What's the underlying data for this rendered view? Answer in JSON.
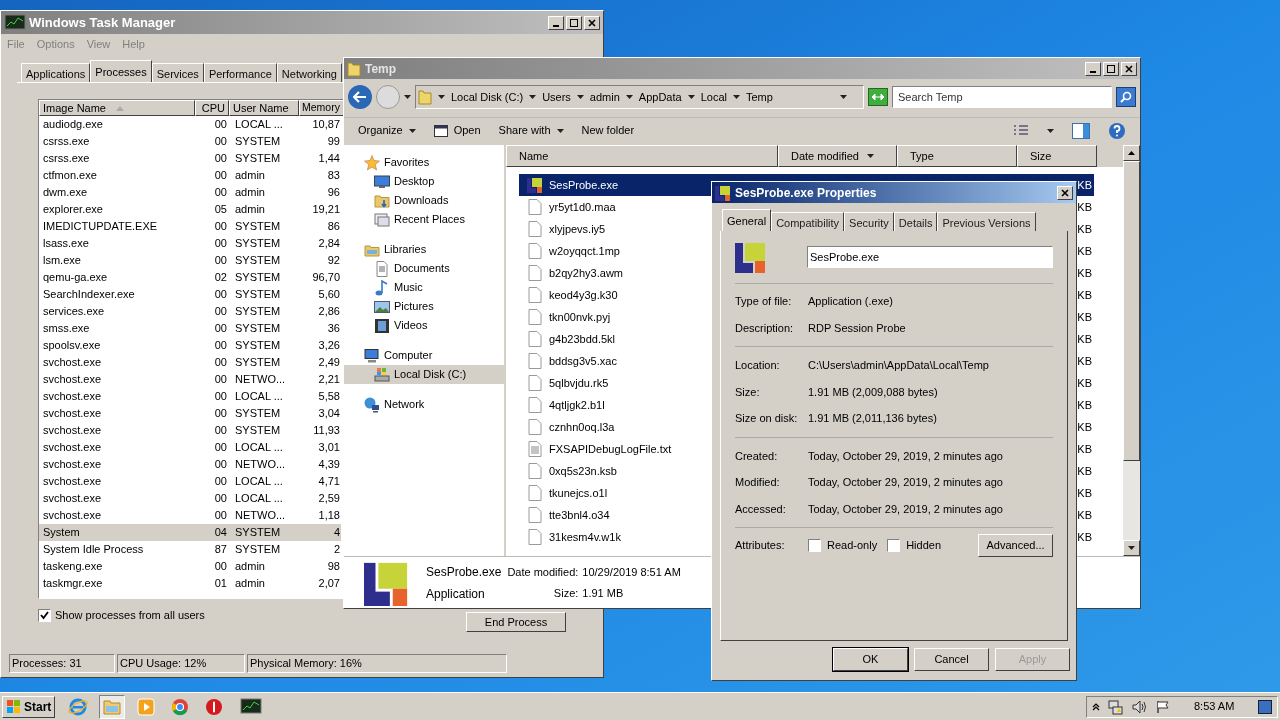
{
  "task_manager": {
    "title": "Windows Task Manager",
    "menu": [
      "File",
      "Options",
      "View",
      "Help"
    ],
    "tabs": [
      {
        "label": "Applications",
        "selected": false
      },
      {
        "label": "Processes",
        "selected": true
      },
      {
        "label": "Services",
        "selected": false
      },
      {
        "label": "Performance",
        "selected": false
      },
      {
        "label": "Networking",
        "selected": false
      }
    ],
    "columns": [
      "Image Name",
      "CPU",
      "User Name",
      "Memory"
    ],
    "rows": [
      {
        "name": "audiodg.exe",
        "cpu": "00",
        "user": "LOCAL ...",
        "memory": "10,87",
        "selected": false
      },
      {
        "name": "csrss.exe",
        "cpu": "00",
        "user": "SYSTEM",
        "memory": "99",
        "selected": false
      },
      {
        "name": "csrss.exe",
        "cpu": "00",
        "user": "SYSTEM",
        "memory": "1,44",
        "selected": false
      },
      {
        "name": "ctfmon.exe",
        "cpu": "00",
        "user": "admin",
        "memory": "83",
        "selected": false
      },
      {
        "name": "dwm.exe",
        "cpu": "00",
        "user": "admin",
        "memory": "96",
        "selected": false
      },
      {
        "name": "explorer.exe",
        "cpu": "05",
        "user": "admin",
        "memory": "19,21",
        "selected": false
      },
      {
        "name": "IMEDICTUPDATE.EXE",
        "cpu": "00",
        "user": "SYSTEM",
        "memory": "86",
        "selected": false
      },
      {
        "name": "lsass.exe",
        "cpu": "00",
        "user": "SYSTEM",
        "memory": "2,84",
        "selected": false
      },
      {
        "name": "lsm.exe",
        "cpu": "00",
        "user": "SYSTEM",
        "memory": "92",
        "selected": false
      },
      {
        "name": "qemu-ga.exe",
        "cpu": "02",
        "user": "SYSTEM",
        "memory": "96,70",
        "selected": false
      },
      {
        "name": "SearchIndexer.exe",
        "cpu": "00",
        "user": "SYSTEM",
        "memory": "5,60",
        "selected": false
      },
      {
        "name": "services.exe",
        "cpu": "00",
        "user": "SYSTEM",
        "memory": "2,86",
        "selected": false
      },
      {
        "name": "smss.exe",
        "cpu": "00",
        "user": "SYSTEM",
        "memory": "36",
        "selected": false
      },
      {
        "name": "spoolsv.exe",
        "cpu": "00",
        "user": "SYSTEM",
        "memory": "3,26",
        "selected": false
      },
      {
        "name": "svchost.exe",
        "cpu": "00",
        "user": "SYSTEM",
        "memory": "2,49",
        "selected": false
      },
      {
        "name": "svchost.exe",
        "cpu": "00",
        "user": "NETWO...",
        "memory": "2,21",
        "selected": false
      },
      {
        "name": "svchost.exe",
        "cpu": "00",
        "user": "LOCAL ...",
        "memory": "5,58",
        "selected": false
      },
      {
        "name": "svchost.exe",
        "cpu": "00",
        "user": "SYSTEM",
        "memory": "3,04",
        "selected": false
      },
      {
        "name": "svchost.exe",
        "cpu": "00",
        "user": "SYSTEM",
        "memory": "11,93",
        "selected": false
      },
      {
        "name": "svchost.exe",
        "cpu": "00",
        "user": "LOCAL ...",
        "memory": "3,01",
        "selected": false
      },
      {
        "name": "svchost.exe",
        "cpu": "00",
        "user": "NETWO...",
        "memory": "4,39",
        "selected": false
      },
      {
        "name": "svchost.exe",
        "cpu": "00",
        "user": "LOCAL ...",
        "memory": "4,71",
        "selected": false
      },
      {
        "name": "svchost.exe",
        "cpu": "00",
        "user": "LOCAL ...",
        "memory": "2,59",
        "selected": false
      },
      {
        "name": "svchost.exe",
        "cpu": "00",
        "user": "NETWO...",
        "memory": "1,18",
        "selected": false
      },
      {
        "name": "System",
        "cpu": "04",
        "user": "SYSTEM",
        "memory": "4",
        "selected": true
      },
      {
        "name": "System Idle Process",
        "cpu": "87",
        "user": "SYSTEM",
        "memory": "2",
        "selected": false
      },
      {
        "name": "taskeng.exe",
        "cpu": "00",
        "user": "admin",
        "memory": "98",
        "selected": false
      },
      {
        "name": "taskmgr.exe",
        "cpu": "01",
        "user": "admin",
        "memory": "2,07",
        "selected": false
      }
    ],
    "show_all_users": {
      "label": "Show processes from all users",
      "checked": true
    },
    "end_process": "End Process",
    "status": [
      "Processes: 31",
      "CPU Usage: 12%",
      "Physical Memory: 16%"
    ]
  },
  "explorer": {
    "title": "Temp",
    "breadcrumbs": [
      "Local Disk (C:)",
      "Users",
      "admin",
      "AppData",
      "Local",
      "Temp"
    ],
    "search": {
      "placeholder": "Search Temp"
    },
    "toolbar": [
      {
        "label": "Organize",
        "kind": "menu"
      },
      {
        "label": "Open",
        "kind": "open"
      },
      {
        "label": "Share with",
        "kind": "menu"
      },
      {
        "label": "New folder",
        "kind": "plain"
      }
    ],
    "nav": [
      {
        "label": "Favorites",
        "kind": "favorites",
        "selected": false,
        "children": [
          {
            "label": "Desktop",
            "kind": "desktop",
            "selected": false
          },
          {
            "label": "Downloads",
            "kind": "downloads",
            "selected": false
          },
          {
            "label": "Recent Places",
            "kind": "recent",
            "selected": false
          }
        ]
      },
      {
        "label": "Libraries",
        "kind": "libraries",
        "selected": false,
        "children": [
          {
            "label": "Documents",
            "kind": "documents",
            "selected": false
          },
          {
            "label": "Music",
            "kind": "music",
            "selected": false
          },
          {
            "label": "Pictures",
            "kind": "pictures",
            "selected": false
          },
          {
            "label": "Videos",
            "kind": "videos",
            "selected": false
          }
        ]
      },
      {
        "label": "Computer",
        "kind": "computer",
        "selected": false,
        "children": [
          {
            "label": "Local Disk (C:)",
            "kind": "disk",
            "selected": true
          }
        ]
      },
      {
        "label": "Network",
        "kind": "network",
        "selected": false
      }
    ],
    "columns": [
      "Name",
      "Date modified",
      "Type",
      "Size"
    ],
    "files": [
      {
        "name": "SesProbe.exe",
        "kind": "exe",
        "size": "KB",
        "selected": true
      },
      {
        "name": "yr5yt1d0.maa",
        "kind": "file",
        "size": "KB",
        "selected": false
      },
      {
        "name": "xlyjpevs.iy5",
        "kind": "file",
        "size": "KB",
        "selected": false
      },
      {
        "name": "w2oyqqct.1mp",
        "kind": "file",
        "size": "KB",
        "selected": false
      },
      {
        "name": "b2qy2hy3.awm",
        "kind": "file",
        "size": "KB",
        "selected": false
      },
      {
        "name": "keod4y3g.k30",
        "kind": "file",
        "size": "KB",
        "selected": false
      },
      {
        "name": "tkn00nvk.pyj",
        "kind": "file",
        "size": "KB",
        "selected": false
      },
      {
        "name": "g4b23bdd.5kl",
        "kind": "file",
        "size": "KB",
        "selected": false
      },
      {
        "name": "bddsg3v5.xac",
        "kind": "file",
        "size": "KB",
        "selected": false
      },
      {
        "name": "5qlbvjdu.rk5",
        "kind": "file",
        "size": "KB",
        "selected": false
      },
      {
        "name": "4qtljgk2.b1l",
        "kind": "file",
        "size": "KB",
        "selected": false
      },
      {
        "name": "cznhn0oq.l3a",
        "kind": "file",
        "size": "KB",
        "selected": false
      },
      {
        "name": "FXSAPIDebugLogFile.txt",
        "kind": "text",
        "size": "KB",
        "selected": false
      },
      {
        "name": "0xq5s23n.ksb",
        "kind": "file",
        "size": "KB",
        "selected": false
      },
      {
        "name": "tkunejcs.o1l",
        "kind": "file",
        "size": "KB",
        "selected": false
      },
      {
        "name": "tte3bnl4.o34",
        "kind": "file",
        "size": "KB",
        "selected": false
      },
      {
        "name": "31kesm4v.w1k",
        "kind": "file",
        "size": "KB",
        "selected": false
      }
    ],
    "details": {
      "name": "SesProbe.exe",
      "type": "Application",
      "date_label": "Date modified:",
      "date": "10/29/2019 8:51 AM",
      "size_label": "Size:",
      "size": "1.91 MB"
    }
  },
  "properties": {
    "title": "SesProbe.exe Properties",
    "tabs": [
      {
        "label": "General",
        "selected": true
      },
      {
        "label": "Compatibility",
        "selected": false
      },
      {
        "label": "Security",
        "selected": false
      },
      {
        "label": "Details",
        "selected": false
      },
      {
        "label": "Previous Versions",
        "selected": false
      }
    ],
    "file_name": "SesProbe.exe",
    "sections": [
      [
        {
          "label": "Type of file:",
          "value": "Application (.exe)"
        },
        {
          "label": "Description:",
          "value": "RDP Session Probe"
        }
      ],
      [
        {
          "label": "Location:",
          "value": "C:\\Users\\admin\\AppData\\Local\\Temp"
        },
        {
          "label": "Size:",
          "value": "1.91 MB (2,009,088 bytes)"
        },
        {
          "label": "Size on disk:",
          "value": "1.91 MB (2,011,136 bytes)"
        }
      ],
      [
        {
          "label": "Created:",
          "value": "Today, October 29, 2019, 2 minutes ago"
        },
        {
          "label": "Modified:",
          "value": "Today, October 29, 2019, 2 minutes ago"
        },
        {
          "label": "Accessed:",
          "value": "Today, October 29, 2019, 2 minutes ago"
        }
      ]
    ],
    "attributes_label": "Attributes:",
    "attributes": [
      {
        "label": "Read-only",
        "checked": false
      },
      {
        "label": "Hidden",
        "checked": false
      }
    ],
    "advanced": "Advanced...",
    "buttons": [
      {
        "label": "OK",
        "disabled": false
      },
      {
        "label": "Cancel",
        "disabled": false
      },
      {
        "label": "Apply",
        "disabled": true
      }
    ]
  },
  "taskbar": {
    "start": "Start",
    "apps": [
      {
        "kind": "ie",
        "active": false
      },
      {
        "kind": "explorer",
        "active": true
      },
      {
        "kind": "media",
        "active": false
      },
      {
        "kind": "chrome",
        "active": false
      },
      {
        "kind": "opera",
        "active": false
      },
      {
        "kind": "taskmgr",
        "active": false
      }
    ],
    "clock": "8:53 AM"
  }
}
